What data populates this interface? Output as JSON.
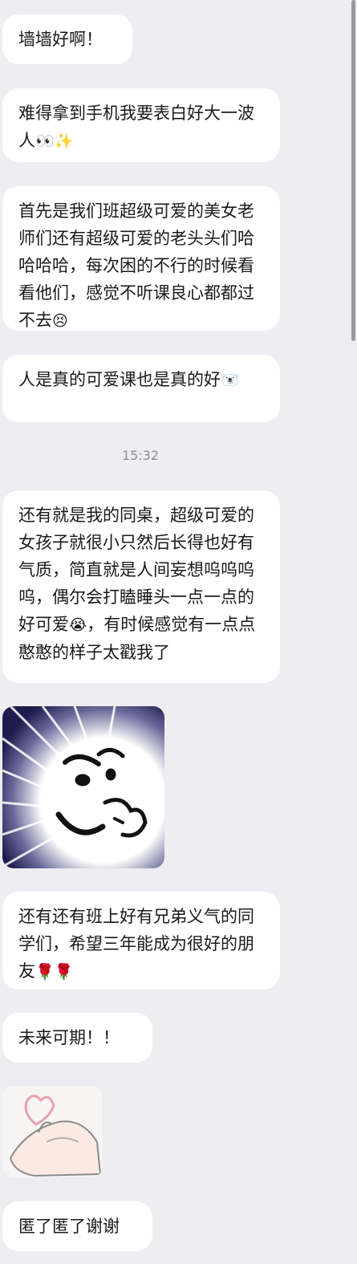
{
  "messages": [
    {
      "text": "墙墙好啊！"
    },
    {
      "text": "难得拿到手机我要表白好大一波人",
      "emoji": "👀✨"
    },
    {
      "text": "首先是我们班超级可爱的美女老师们还有超级可爱的老头头们哈哈哈哈，每次困的不行的时候看看他们，感觉不听课良心都都过不去",
      "emoji": "😣"
    },
    {
      "text": "人是真的可爱课也是真的好",
      "emoji": "🐻‍❄️"
    },
    {
      "text_before": "还有就是我的同桌，超级可爱的女孩子就很小只然后长得也好有气质，简直就是人间妄想呜呜呜呜，偶尔会打瞌睡头一点一点的好可爱",
      "emoji": "😭",
      "text_after": "，有时候感觉有一点点憨憨的样子太戳我了"
    },
    {
      "text": "还有还有班上好有兄弟义气的同学们，希望三年能成为很好的朋友",
      "emoji": "🌹🌹"
    },
    {
      "text": "未来可期！！"
    },
    {
      "text": "匿了匿了谢谢"
    }
  ],
  "timestamp": "15:32",
  "stickers": {
    "first": "meme-face-sticker",
    "second": "finger-heart-sticker"
  }
}
